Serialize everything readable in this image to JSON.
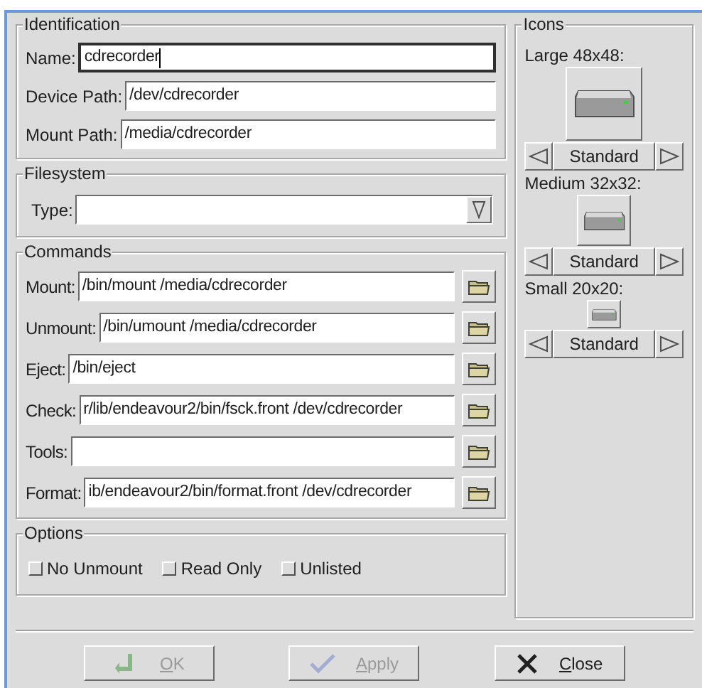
{
  "identification": {
    "title": "Identification",
    "fields": [
      {
        "label": "Name:",
        "value": "cdrecorder",
        "focused": true
      },
      {
        "label": "Device Path:",
        "value": "/dev/cdrecorder",
        "focused": false
      },
      {
        "label": "Mount Path:",
        "value": "/media/cdrecorder",
        "focused": false
      }
    ]
  },
  "filesystem": {
    "title": "Filesystem",
    "label": "Type:"
  },
  "commands": {
    "title": "Commands",
    "rows": [
      {
        "label": "Mount:",
        "value": "/bin/mount /media/cdrecorder"
      },
      {
        "label": "Unmount:",
        "value": "/bin/umount /media/cdrecorder"
      },
      {
        "label": "Eject:",
        "value": "/bin/eject"
      },
      {
        "label": "Check:",
        "value": "r/lib/endeavour2/bin/fsck.front /dev/cdrecorder"
      },
      {
        "label": "Tools:"
      },
      {
        "label": "Format:",
        "value": "ib/endeavour2/bin/format.front /dev/cdrecorder"
      }
    ]
  },
  "options": {
    "title": "Options",
    "items": [
      {
        "label": "No Unmount",
        "checked": false
      },
      {
        "label": "Read Only",
        "checked": false
      },
      {
        "label": "Unlisted",
        "checked": false
      }
    ]
  },
  "icons": {
    "title": "Icons",
    "sizes": [
      {
        "label": "Large 48x48:",
        "kind": "large",
        "style": "Standard"
      },
      {
        "label": "Medium 32x32:",
        "kind": "medium",
        "style": "Standard"
      },
      {
        "label": "Small 20x20:",
        "kind": "small",
        "style": "Standard"
      }
    ]
  },
  "buttons": [
    {
      "label": "OK",
      "kind": "ok",
      "disabled": true
    },
    {
      "label": "Apply",
      "kind": "apply",
      "disabled": true
    },
    {
      "label": "Close",
      "kind": "close",
      "disabled": false
    }
  ]
}
